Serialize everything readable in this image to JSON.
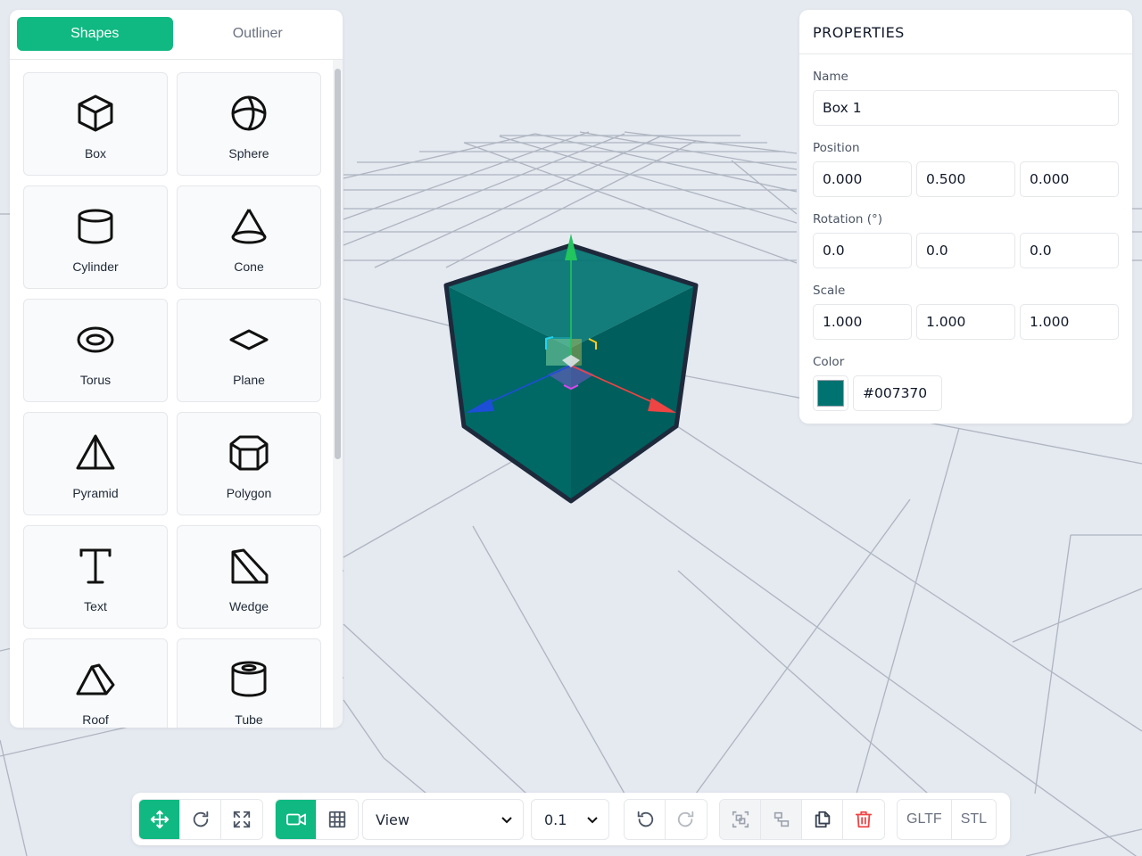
{
  "tabs": {
    "shapes": "Shapes",
    "outliner": "Outliner"
  },
  "shapes": [
    {
      "label": "Box",
      "icon": "box-icon"
    },
    {
      "label": "Sphere",
      "icon": "sphere-icon"
    },
    {
      "label": "Cylinder",
      "icon": "cylinder-icon"
    },
    {
      "label": "Cone",
      "icon": "cone-icon"
    },
    {
      "label": "Torus",
      "icon": "torus-icon"
    },
    {
      "label": "Plane",
      "icon": "plane-icon"
    },
    {
      "label": "Pyramid",
      "icon": "pyramid-icon"
    },
    {
      "label": "Polygon",
      "icon": "polygon-icon"
    },
    {
      "label": "Text",
      "icon": "text-icon"
    },
    {
      "label": "Wedge",
      "icon": "wedge-icon"
    },
    {
      "label": "Roof",
      "icon": "roof-icon"
    },
    {
      "label": "Tube",
      "icon": "tube-icon"
    }
  ],
  "properties": {
    "title": "PROPERTIES",
    "name_label": "Name",
    "name_value": "Box 1",
    "position_label": "Position",
    "position": [
      "0.000",
      "0.500",
      "0.000"
    ],
    "rotation_label": "Rotation (°)",
    "rotation": [
      "0.0",
      "0.0",
      "0.0"
    ],
    "scale_label": "Scale",
    "scale": [
      "1.000",
      "1.000",
      "1.000"
    ],
    "color_label": "Color",
    "color_value": "#007370"
  },
  "toolbar": {
    "transform_buttons": [
      "move-icon",
      "rotate-icon",
      "scale-icon"
    ],
    "view_buttons": [
      "camera-icon",
      "grid-icon"
    ],
    "view_select": "View",
    "snap_select": "0.1",
    "history_buttons": [
      "undo-icon",
      "redo-icon"
    ],
    "edit_buttons": [
      "group-icon",
      "ungroup-icon",
      "duplicate-icon",
      "delete-icon"
    ],
    "export_gltf": "GLTF",
    "export_stl": "STL"
  },
  "colors": {
    "accent": "#10b981",
    "box_color": "#007370",
    "delete": "#ef4444",
    "axis_x": "#ef4444",
    "axis_y": "#22c55e",
    "axis_z": "#1d4ed8"
  }
}
